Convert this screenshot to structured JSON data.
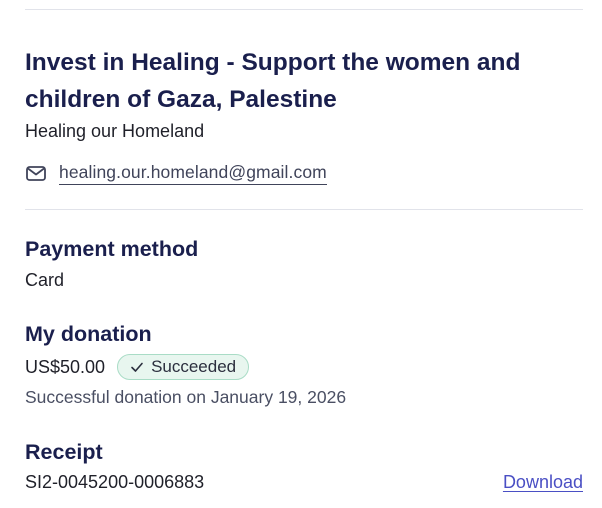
{
  "campaign": {
    "title": "Invest in Healing - Support the women and children of Gaza, Palestine",
    "organizer": "Healing our Homeland",
    "email_icon": "mail-icon",
    "email": "healing.our.homeland@gmail.com"
  },
  "payment": {
    "heading": "Payment method",
    "value": "Card"
  },
  "donation": {
    "heading": "My donation",
    "amount": "US$50.00",
    "status_icon": "check-icon",
    "status": "Succeeded",
    "date_text": "Successful donation on January 19, 2026"
  },
  "receipt": {
    "heading": "Receipt",
    "number": "SI2-0045200-0006883",
    "download_label": "Download"
  },
  "colors": {
    "heading": "#1a1f4d",
    "link": "#4a4fc4",
    "badge_bg": "#e8f6ef",
    "badge_border": "#a9dcc6",
    "divider": "#e1e3ea"
  }
}
